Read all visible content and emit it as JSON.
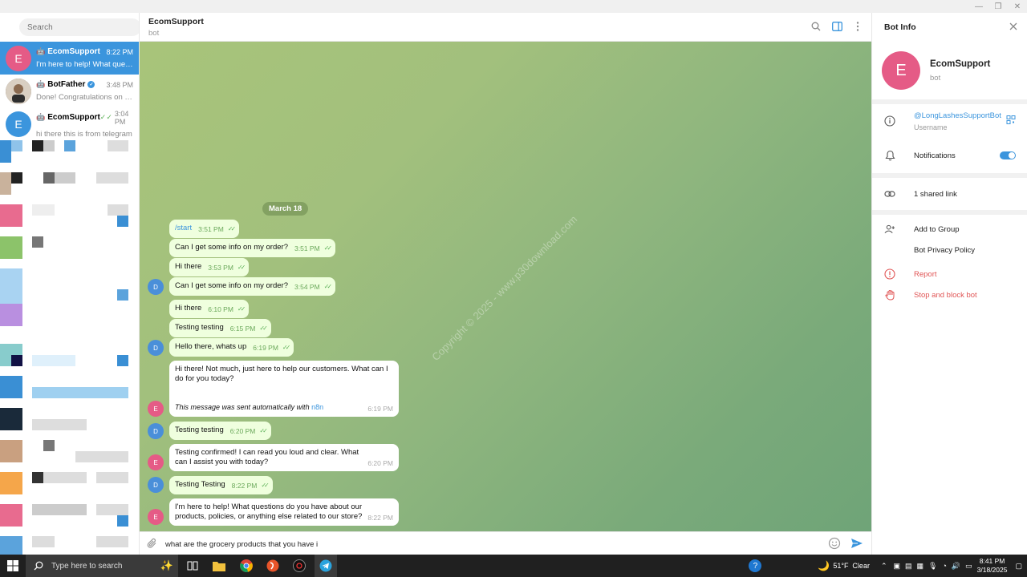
{
  "window": {
    "minimize": "—",
    "maximize": "❐",
    "close": "✕"
  },
  "sidebar": {
    "search_placeholder": "Search",
    "chats": [
      {
        "initial": "E",
        "name": "EcomSupport",
        "time": "8:22 PM",
        "preview": "I'm here to help! What questi...",
        "color": "#e55b86",
        "active": true,
        "bot": true
      },
      {
        "initial": "",
        "name": "BotFather",
        "time": "3:48 PM",
        "preview": "Done! Congratulations on yo...",
        "color": "#6b5b4a",
        "active": false,
        "bot": true,
        "verified": true
      },
      {
        "initial": "E",
        "name": "EcomSupport",
        "time": "3:04 PM",
        "preview": "hi there this is from telegram",
        "color": "#3b95dd",
        "active": false,
        "bot": true,
        "read": true
      }
    ]
  },
  "header": {
    "title": "EcomSupport",
    "subtitle": "bot"
  },
  "chat": {
    "date": "March 18",
    "messages": [
      {
        "text": "/start",
        "time": "3:51 PM"
      },
      {
        "text": "Can I get some info on my order?",
        "time": "3:51 PM"
      },
      {
        "text": "Hi there",
        "time": "3:53 PM"
      },
      {
        "text": "Can I get some info on my order?",
        "time": "3:54 PM"
      },
      {
        "text": "Hi there",
        "time": "6:10 PM"
      },
      {
        "text": "Testing testing",
        "time": "6:15 PM"
      },
      {
        "text": "Hello there, whats up",
        "time": "6:19 PM"
      },
      {
        "text": "Hi there! Not much, just here to help our customers. What can I do for you today?",
        "footer": "This message was sent automatically with",
        "footer_link": "n8n",
        "time": "6:19 PM"
      },
      {
        "text": "Testing testing",
        "time": "6:20 PM"
      },
      {
        "text": "Testing confirmed! I can read you loud and clear. What can I assist you with today?",
        "time": "6:20 PM"
      },
      {
        "text": "Testing Testing",
        "time": "8:22 PM"
      },
      {
        "text": "I'm here to help! What questions do you have about our products, policies, or anything else related to our store?",
        "time": "8:22 PM"
      }
    ],
    "avatar_d": "D",
    "avatar_e": "E",
    "watermark": "Copyright © 2025 - www.p30download.com"
  },
  "input": {
    "value": "what are the grocery products that you have i"
  },
  "panel": {
    "title": "Bot Info",
    "initial": "E",
    "name": "EcomSupport",
    "status": "bot",
    "username": "@LongLashesSupportBot",
    "username_label": "Username",
    "notifications": "Notifications",
    "shared_link": "1 shared link",
    "add_to_group": "Add to Group",
    "privacy": "Bot Privacy Policy",
    "report": "Report",
    "stop": "Stop and block bot"
  },
  "taskbar": {
    "search": "Type here to search",
    "weather": "51°F  Clear",
    "time": "8:41 PM",
    "date": "3/18/2025"
  },
  "colors": {
    "accent": "#3b95dd",
    "danger": "#e05454",
    "bubble_out": "#efffde"
  }
}
